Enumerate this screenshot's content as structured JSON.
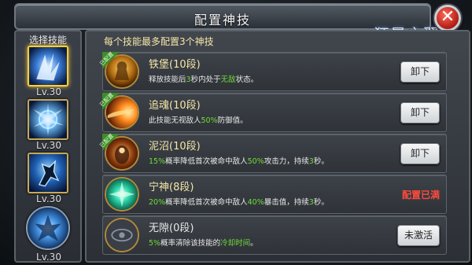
{
  "window": {
    "title": "配置神技",
    "logo_text": "狂暴之翼",
    "close_symbol": "✕"
  },
  "left_panel": {
    "title": "选择技能",
    "slots": [
      {
        "level": "Lv.30",
        "icon": "wing-slash-icon",
        "selected": true
      },
      {
        "level": "Lv.30",
        "icon": "lightning-burst-icon",
        "selected": false
      },
      {
        "level": "Lv.30",
        "icon": "warrior-leap-icon",
        "selected": false
      },
      {
        "level": "Lv.30",
        "icon": "ultimate-aura-icon",
        "selected": false
      }
    ]
  },
  "main": {
    "subtitle": "每个技能最多配置3个神技",
    "equipped_ribbon": "已配置",
    "skills": [
      {
        "name": "铁堡(10段)",
        "desc_parts": [
          "释放技能后",
          "3",
          "秒内处于",
          "无敌",
          "状态。"
        ],
        "action": "卸下",
        "equipped": true,
        "icon": "iron-fortress-icon"
      },
      {
        "name": "追魂(10段)",
        "desc_parts": [
          "此技能无视敌人",
          "50%",
          "防御值。"
        ],
        "action": "卸下",
        "equipped": true,
        "icon": "soul-chase-icon"
      },
      {
        "name": "泥沼(10段)",
        "desc_parts": [
          "15%",
          "概率降低首次被命中敌人",
          "50%",
          "攻击力，持续",
          "3",
          "秒。"
        ],
        "action": "卸下",
        "equipped": true,
        "icon": "swamp-icon"
      },
      {
        "name": "宁神(8段)",
        "desc_parts": [
          "20%",
          "概率降低首次被命中敌人",
          "40%",
          "暴击值，持续",
          "3",
          "秒。"
        ],
        "action": "配置已满",
        "equipped": false,
        "icon": "calm-spirit-icon"
      },
      {
        "name": "无隙(0段)",
        "desc_parts": [
          "5%",
          "概率清除该技能的",
          "冷却时间",
          "。"
        ],
        "action": "未激活",
        "equipped": false,
        "icon": "seamless-eye-icon"
      }
    ]
  },
  "colors": {
    "highlight_green": "#6fdc3a",
    "name_gold": "#f5e6a8",
    "full_red": "#ff4a3d",
    "ribbon_green": "#3e8c2a"
  }
}
